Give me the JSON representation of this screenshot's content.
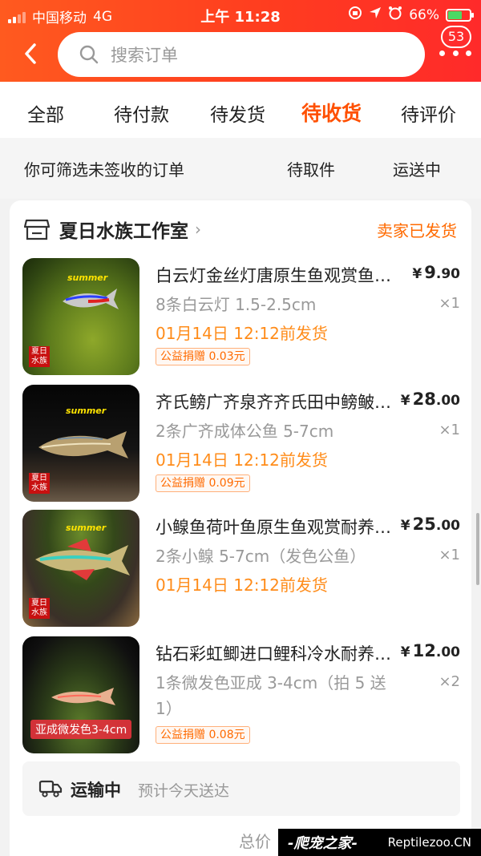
{
  "status_bar": {
    "carrier": "中国移动",
    "network": "4G",
    "time": "上午 11:28",
    "battery": "66%"
  },
  "header": {
    "search_placeholder": "搜索订单",
    "badge_count": "53"
  },
  "tabs": [
    {
      "label": "全部"
    },
    {
      "label": "待付款"
    },
    {
      "label": "待发货"
    },
    {
      "label": "待收货",
      "active": true
    },
    {
      "label": "待评价"
    }
  ],
  "filter": {
    "hint": "你可筛选未签收的订单",
    "chip1": "待取件",
    "chip2": "运送中"
  },
  "order": {
    "shop_name": "夏日水族工作室",
    "status": "卖家已发货",
    "items": [
      {
        "title": "白云灯金丝灯唐原生鱼观赏鱼活体",
        "price_symbol": "¥",
        "price_int": "9",
        "price_dec": ".90",
        "spec": "8条白云灯 1.5-2.5cm",
        "qty": "×1",
        "ship": "01月14日 12:12前发货",
        "charity": "公益捐赠 0.03元",
        "thumb_text": "summer"
      },
      {
        "title": "齐氏鳑广齐泉齐齐氏田中鳑鲏原生鱼",
        "price_symbol": "¥",
        "price_int": "28",
        "price_dec": ".00",
        "spec": "2条广齐成体公鱼 5-7cm",
        "qty": "×1",
        "ship": "01月14日 12:12前发货",
        "charity": "公益捐赠 0.09元",
        "thumb_text": "summer"
      },
      {
        "title": "小鳈鱼荷叶鱼原生鱼观赏耐养冷水鱼",
        "price_symbol": "¥",
        "price_int": "25",
        "price_dec": ".00",
        "spec": "2条小鳈 5-7cm（发色公鱼）",
        "qty": "×1",
        "ship": "01月14日 12:12前发货",
        "charity": "",
        "thumb_text": "summer"
      },
      {
        "title": "钻石彩虹鲫进口鲤科冷水耐养观赏鱼",
        "price_symbol": "¥",
        "price_int": "12",
        "price_dec": ".00",
        "spec": "1条微发色亚成 3-4cm（拍 5 送1）",
        "qty": "×2",
        "ship": "",
        "charity": "公益捐赠 0.08元",
        "thumb_text": "亚成微发色3-4cm"
      }
    ],
    "transit_status": "运输中",
    "transit_eta": "预计今天送达",
    "total_label": "总价"
  },
  "watermark": {
    "cn": "-爬宠之家-",
    "en": "Reptilezoo.CN"
  },
  "colors": {
    "accent": "#ff5000",
    "ship_orange": "#ff8c1a",
    "header_red": "#ff3d1f"
  }
}
